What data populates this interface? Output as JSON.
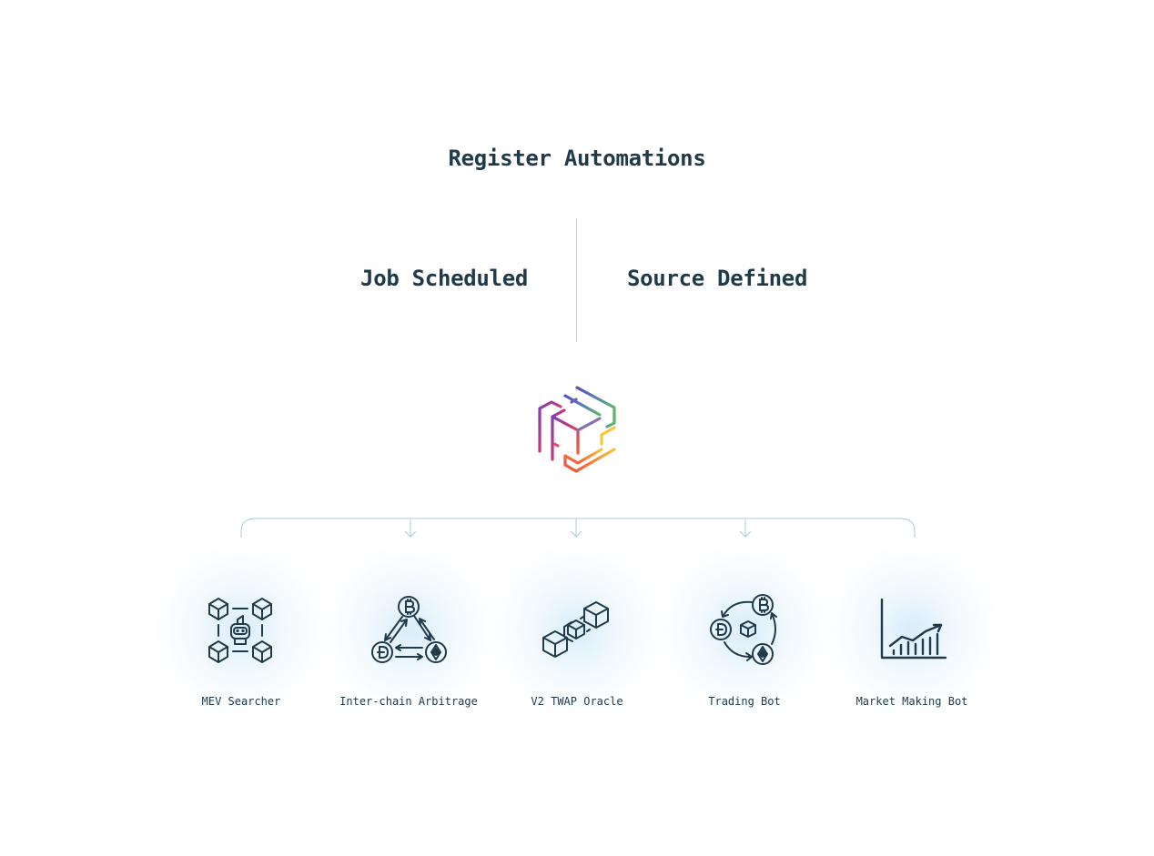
{
  "title": "Register Automations",
  "split": {
    "left": "Job Scheduled",
    "right": "Source Defined"
  },
  "use_cases": [
    {
      "label": "MEV Searcher",
      "icon": "mev-searcher-icon"
    },
    {
      "label": "Inter-chain Arbitrage",
      "icon": "arbitrage-icon"
    },
    {
      "label": "V2 TWAP Oracle",
      "icon": "oracle-icon"
    },
    {
      "label": "Trading Bot",
      "icon": "trading-bot-icon"
    },
    {
      "label": "Market Making Bot",
      "icon": "market-making-chart-icon"
    }
  ],
  "colors": {
    "text": "#1f3a4a",
    "divider": "#b9d4de",
    "glow": "#d7ecfa",
    "logo_gradient": [
      "#7b3fb8",
      "#c2377a",
      "#ee5a3a",
      "#f5b63a",
      "#5ab56b",
      "#5a6fc2"
    ]
  }
}
